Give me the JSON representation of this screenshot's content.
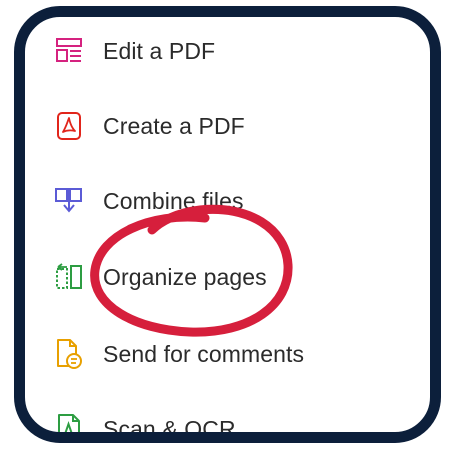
{
  "tools": [
    {
      "label": "Edit a PDF",
      "icon": "edit-pdf-icon",
      "color": "#d5227f"
    },
    {
      "label": "Create a PDF",
      "icon": "create-pdf-icon",
      "color": "#e1251b"
    },
    {
      "label": "Combine files",
      "icon": "combine-files-icon",
      "color": "#5b5bd6"
    },
    {
      "label": "Organize pages",
      "icon": "organize-pages-icon",
      "color": "#2d9d42"
    },
    {
      "label": "Send for comments",
      "icon": "send-comments-icon",
      "color": "#e8a000"
    },
    {
      "label": "Scan & OCR",
      "icon": "scan-ocr-icon",
      "color": "#2d9d42"
    }
  ],
  "colors": {
    "frame_border": "#0c1f3b",
    "highlight_circle": "#d61f3c",
    "label_text": "#2b2b2b"
  }
}
